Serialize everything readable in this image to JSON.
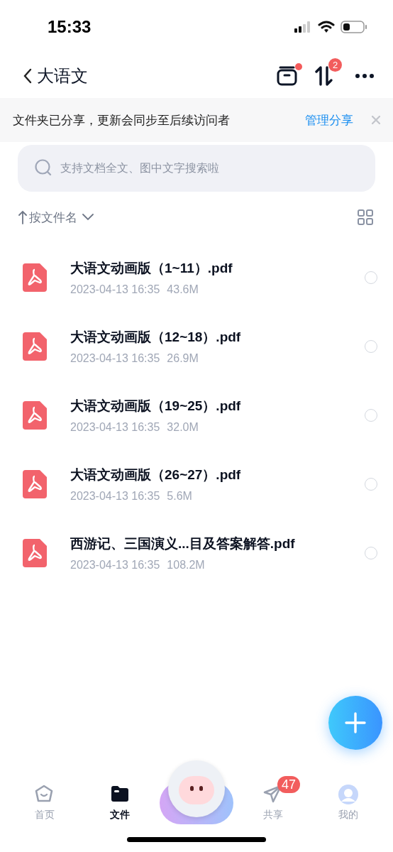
{
  "status_bar": {
    "time": "15:33"
  },
  "nav": {
    "back_title": "大语文",
    "inbox_dot": true,
    "transfer_badge": "2"
  },
  "banner": {
    "message": "文件夹已分享，更新会同步至后续访问者",
    "action": "管理分享"
  },
  "search": {
    "placeholder": "支持文档全文、图中文字搜索啦"
  },
  "sort": {
    "label": "按文件名"
  },
  "files": [
    {
      "name": "大语文动画版（1~11）.pdf",
      "date": "2023-04-13 16:35",
      "size": "43.6M",
      "selected": false
    },
    {
      "name": "大语文动画版（12~18）.pdf",
      "date": "2023-04-13 16:35",
      "size": "26.9M",
      "selected": false
    },
    {
      "name": "大语文动画版（19~25）.pdf",
      "date": "2023-04-13 16:35",
      "size": "32.0M",
      "selected": false
    },
    {
      "name": "大语文动画版（26~27）.pdf",
      "date": "2023-04-13 16:35",
      "size": "5.6M",
      "selected": false
    },
    {
      "name": "西游记、三国演义...目及答案解答.pdf",
      "date": "2023-04-13 16:35",
      "size": "108.2M",
      "selected": false
    }
  ],
  "tabs": [
    {
      "kind": "home",
      "label": "首页",
      "selected": false
    },
    {
      "kind": "files",
      "label": "文件",
      "selected": true
    },
    {
      "kind": "mascot"
    },
    {
      "kind": "share",
      "label": "共享",
      "selected": false,
      "badge": "47"
    },
    {
      "kind": "me",
      "label": "我的",
      "selected": false
    }
  ]
}
